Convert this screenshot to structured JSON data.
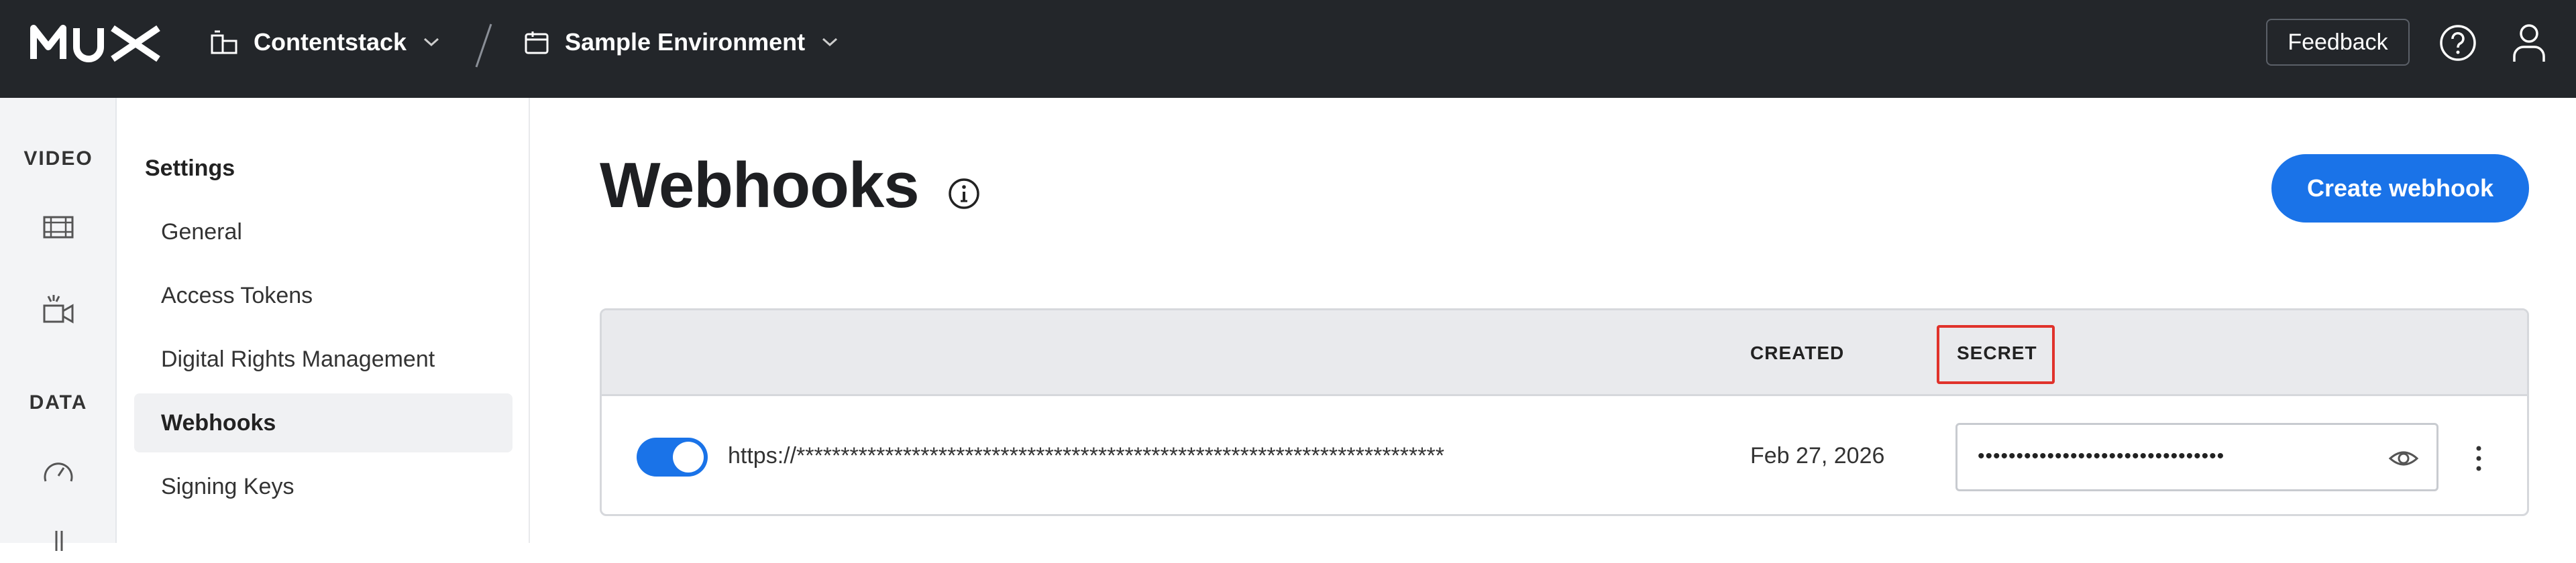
{
  "app": {
    "logo": "MUX"
  },
  "header": {
    "org_name": "Contentstack",
    "env_name": "Sample Environment",
    "feedback_label": "Feedback"
  },
  "rail": {
    "video_label": "VIDEO",
    "data_label": "DATA",
    "icons": [
      "film-icon",
      "live-camera-icon",
      "gauge-icon"
    ]
  },
  "nav": {
    "title": "Settings",
    "items": [
      {
        "label": "General"
      },
      {
        "label": "Access Tokens"
      },
      {
        "label": "Digital Rights Management"
      },
      {
        "label": "Webhooks",
        "active": true
      },
      {
        "label": "Signing Keys"
      }
    ]
  },
  "main": {
    "title": "Webhooks",
    "create_label": "Create webhook",
    "table": {
      "columns": {
        "created": "CREATED",
        "secret": "SECRET"
      },
      "rows": [
        {
          "enabled": true,
          "url": "https://*************************************************************************",
          "created": "Feb 27, 2026",
          "secret": "••••••••••••••••••••••••••••••••"
        }
      ]
    }
  },
  "colors": {
    "topbar": "#23262a",
    "accent": "#1a73e8",
    "highlight": "#e0322b"
  }
}
